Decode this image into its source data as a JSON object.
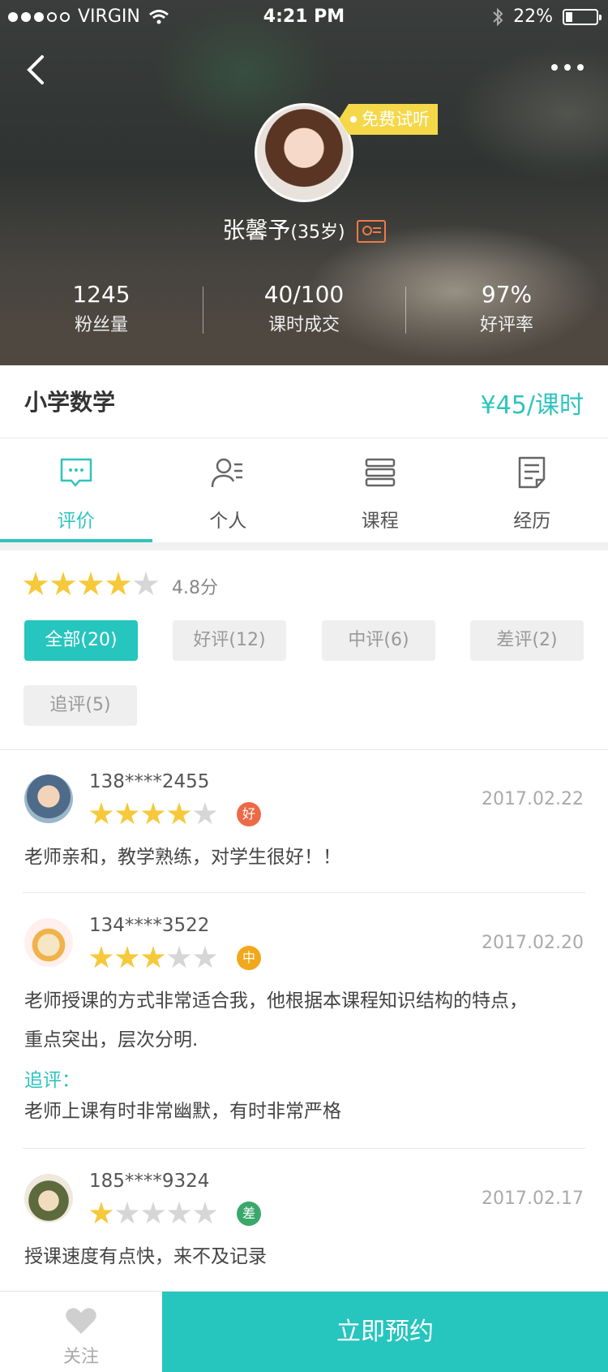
{
  "status_bar": {
    "carrier": "VIRGIN",
    "time": "4:21 PM",
    "battery": "22%"
  },
  "teacher": {
    "name": "张馨予",
    "age": "(35岁)",
    "trial_tag": "免费试听"
  },
  "stats": [
    {
      "value": "1245",
      "label": "粉丝量"
    },
    {
      "value": "40/100",
      "label": "课时成交"
    },
    {
      "value": "97%",
      "label": "好评率"
    }
  ],
  "subject": {
    "name": "小学数学",
    "price": "¥45/课时"
  },
  "tabs": [
    {
      "label": "评价",
      "icon": "chat-bubble-icon"
    },
    {
      "label": "个人",
      "icon": "user-profile-icon"
    },
    {
      "label": "课程",
      "icon": "stack-icon"
    },
    {
      "label": "经历",
      "icon": "document-icon"
    }
  ],
  "rating": {
    "score_text": "4.8分",
    "stars": 4
  },
  "filters": [
    {
      "label": "全部(20)",
      "active": true
    },
    {
      "label": "好评(12)",
      "active": false
    },
    {
      "label": "中评(6)",
      "active": false
    },
    {
      "label": "差评(2)",
      "active": false
    },
    {
      "label": "追评(5)",
      "active": false
    }
  ],
  "reviews": [
    {
      "user": "138****2455",
      "date": "2017.02.22",
      "stars": 4,
      "badge": "好",
      "badge_color": "#ec6a47",
      "text": "老师亲和，教学熟练，对学生很好！！"
    },
    {
      "user": "134****3522",
      "date": "2017.02.20",
      "stars": 3,
      "badge": "中",
      "badge_color": "#f2a81c",
      "text_line1": "老师授课的方式非常适合我，他根据本课程知识结构的特点，",
      "text_line2": "重点突出，层次分明.",
      "follow_label": "追评：",
      "follow_text": "老师上课有时非常幽默，有时非常严格"
    },
    {
      "user": "185****9324",
      "date": "2017.02.17",
      "stars": 1,
      "badge": "差",
      "badge_color": "#3aa86b",
      "text": "授课速度有点快，来不及记录"
    }
  ],
  "bottom": {
    "follow_label": "关注",
    "book_label": "立即预约"
  },
  "colors": {
    "accent": "#2ec4bd",
    "star_on": "#f6c93a",
    "star_off": "#d6d6d6"
  }
}
